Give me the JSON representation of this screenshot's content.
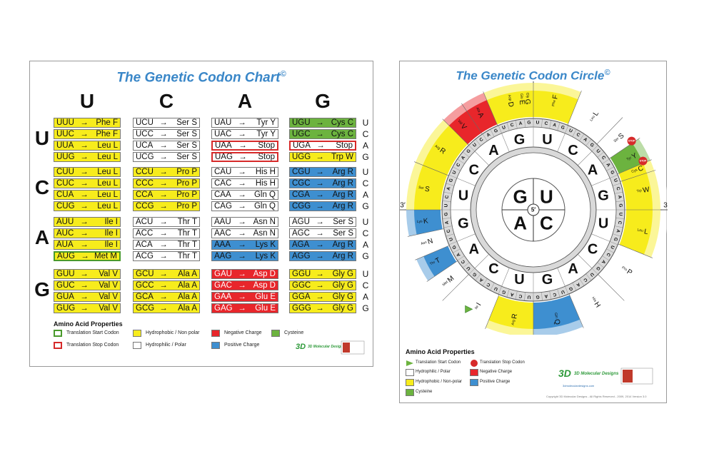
{
  "chart": {
    "title": "The Genetic Codon Chart",
    "title_mark": "©",
    "columns": [
      "U",
      "C",
      "A",
      "G"
    ],
    "rows": [
      "U",
      "C",
      "A",
      "G"
    ],
    "third": [
      "U",
      "C",
      "A",
      "G"
    ],
    "cells": [
      [
        {
          "c": "UUU",
          "a": "Phe F",
          "t": "hphob"
        },
        {
          "c": "UUC",
          "a": "Phe F",
          "t": "hphob"
        },
        {
          "c": "UUA",
          "a": "Leu L",
          "t": "hphob"
        },
        {
          "c": "UUG",
          "a": "Leu L",
          "t": "hphob"
        }
      ],
      [
        {
          "c": "UCU",
          "a": "Ser S",
          "t": "pol"
        },
        {
          "c": "UCC",
          "a": "Ser S",
          "t": "pol"
        },
        {
          "c": "UCA",
          "a": "Ser S",
          "t": "pol"
        },
        {
          "c": "UCG",
          "a": "Ser S",
          "t": "pol"
        }
      ],
      [
        {
          "c": "UAU",
          "a": "Tyr Y",
          "t": "pol"
        },
        {
          "c": "UAC",
          "a": "Tyr Y",
          "t": "pol"
        },
        {
          "c": "UAA",
          "a": "Stop",
          "t": "pol",
          "b": "stop"
        },
        {
          "c": "UAG",
          "a": "Stop",
          "t": "pol",
          "b": "stop"
        }
      ],
      [
        {
          "c": "UGU",
          "a": "Cys C",
          "t": "cys"
        },
        {
          "c": "UGC",
          "a": "Cys C",
          "t": "cys"
        },
        {
          "c": "UGA",
          "a": "Stop",
          "t": "pol",
          "b": "stop"
        },
        {
          "c": "UGG",
          "a": "Trp W",
          "t": "hphob"
        }
      ],
      [
        {
          "c": "CUU",
          "a": "Leu L",
          "t": "hphob"
        },
        {
          "c": "CUC",
          "a": "Leu L",
          "t": "hphob"
        },
        {
          "c": "CUA",
          "a": "Leu L",
          "t": "hphob"
        },
        {
          "c": "CUG",
          "a": "Leu L",
          "t": "hphob"
        }
      ],
      [
        {
          "c": "CCU",
          "a": "Pro P",
          "t": "hphob"
        },
        {
          "c": "CCC",
          "a": "Pro P",
          "t": "hphob"
        },
        {
          "c": "CCA",
          "a": "Pro P",
          "t": "hphob"
        },
        {
          "c": "CCG",
          "a": "Pro P",
          "t": "hphob"
        }
      ],
      [
        {
          "c": "CAU",
          "a": "His H",
          "t": "pol"
        },
        {
          "c": "CAC",
          "a": "His H",
          "t": "pol"
        },
        {
          "c": "CAA",
          "a": "Gln Q",
          "t": "pol"
        },
        {
          "c": "CAG",
          "a": "Gln Q",
          "t": "pol"
        }
      ],
      [
        {
          "c": "CGU",
          "a": "Arg R",
          "t": "pos"
        },
        {
          "c": "CGC",
          "a": "Arg R",
          "t": "pos"
        },
        {
          "c": "CGA",
          "a": "Arg R",
          "t": "pos"
        },
        {
          "c": "CGG",
          "a": "Arg R",
          "t": "pos"
        }
      ],
      [
        {
          "c": "AUU",
          "a": "Ile I",
          "t": "hphob"
        },
        {
          "c": "AUC",
          "a": "Ile I",
          "t": "hphob"
        },
        {
          "c": "AUA",
          "a": "Ile I",
          "t": "hphob"
        },
        {
          "c": "AUG",
          "a": "Met M",
          "t": "hphob",
          "b": "start"
        }
      ],
      [
        {
          "c": "ACU",
          "a": "Thr T",
          "t": "pol"
        },
        {
          "c": "ACC",
          "a": "Thr T",
          "t": "pol"
        },
        {
          "c": "ACA",
          "a": "Thr T",
          "t": "pol"
        },
        {
          "c": "ACG",
          "a": "Thr T",
          "t": "pol"
        }
      ],
      [
        {
          "c": "AAU",
          "a": "Asn N",
          "t": "pol"
        },
        {
          "c": "AAC",
          "a": "Asn N",
          "t": "pol"
        },
        {
          "c": "AAA",
          "a": "Lys K",
          "t": "pos"
        },
        {
          "c": "AAG",
          "a": "Lys K",
          "t": "pos"
        }
      ],
      [
        {
          "c": "AGU",
          "a": "Ser S",
          "t": "pol"
        },
        {
          "c": "AGC",
          "a": "Ser S",
          "t": "pol"
        },
        {
          "c": "AGA",
          "a": "Arg R",
          "t": "pos"
        },
        {
          "c": "AGG",
          "a": "Arg R",
          "t": "pos"
        }
      ],
      [
        {
          "c": "GUU",
          "a": "Val V",
          "t": "hphob"
        },
        {
          "c": "GUC",
          "a": "Val V",
          "t": "hphob"
        },
        {
          "c": "GUA",
          "a": "Val V",
          "t": "hphob"
        },
        {
          "c": "GUG",
          "a": "Val V",
          "t": "hphob"
        }
      ],
      [
        {
          "c": "GCU",
          "a": "Ala A",
          "t": "hphob"
        },
        {
          "c": "GCC",
          "a": "Ala A",
          "t": "hphob"
        },
        {
          "c": "GCA",
          "a": "Ala A",
          "t": "hphob"
        },
        {
          "c": "GCG",
          "a": "Ala A",
          "t": "hphob"
        }
      ],
      [
        {
          "c": "GAU",
          "a": "Asp D",
          "t": "neg"
        },
        {
          "c": "GAC",
          "a": "Asp D",
          "t": "neg"
        },
        {
          "c": "GAA",
          "a": "Glu E",
          "t": "neg"
        },
        {
          "c": "GAG",
          "a": "Glu E",
          "t": "neg"
        }
      ],
      [
        {
          "c": "GGU",
          "a": "Gly G",
          "t": "hphob"
        },
        {
          "c": "GGC",
          "a": "Gly G",
          "t": "hphob"
        },
        {
          "c": "GGA",
          "a": "Gly G",
          "t": "hphob"
        },
        {
          "c": "GGG",
          "a": "Gly G",
          "t": "hphob"
        }
      ]
    ],
    "legend_title": "Amino Acid Properties",
    "legend": {
      "start": "Translation Start Codon",
      "stop": "Translation Stop Codon",
      "hphob": "Hydrophobic / Non polar",
      "pol": "Hydrophilic / Polar",
      "neg": "Negative Charge",
      "pos": "Positive Charge",
      "cys": "Cysteine"
    },
    "logo_text": "3D Molecular Designs"
  },
  "circle": {
    "title": "The Genetic Codon Circle",
    "title_mark": "©",
    "prime3": "3′",
    "prime5": "5′",
    "inner": [
      "U",
      "C",
      "A",
      "G"
    ],
    "ring2": [
      "U",
      "C",
      "A",
      "G",
      "U",
      "C",
      "A",
      "G",
      "U",
      "C",
      "A",
      "G",
      "U",
      "C",
      "A",
      "G"
    ],
    "ring3": [
      "U",
      "C",
      "A",
      "G",
      "U",
      "C",
      "A",
      "G",
      "U",
      "C",
      "A",
      "G",
      "U",
      "C",
      "A",
      "G",
      "U",
      "C",
      "A",
      "G",
      "U",
      "C",
      "A",
      "G",
      "U",
      "C",
      "A",
      "G",
      "U",
      "C",
      "A",
      "G",
      "U",
      "C",
      "A",
      "G",
      "U",
      "C",
      "A",
      "G",
      "U",
      "C",
      "A",
      "G",
      "U",
      "C",
      "A",
      "G",
      "U",
      "C",
      "A",
      "G",
      "U",
      "C",
      "A",
      "G",
      "U",
      "C",
      "A",
      "G",
      "U",
      "C",
      "A",
      "G"
    ],
    "aa_labels": [
      {
        "l": "Phe",
        "s": "F"
      },
      {
        "l": "Leu",
        "s": "L"
      },
      {
        "l": "Ser",
        "s": "S"
      },
      {
        "l": "Tyr",
        "s": "Y"
      },
      {
        "l": "Cys",
        "s": "C"
      },
      {
        "l": "Trp",
        "s": "W"
      },
      {
        "l": "Leu",
        "s": "L"
      },
      {
        "l": "Pro",
        "s": "P"
      },
      {
        "l": "His",
        "s": "H"
      },
      {
        "l": "Gln",
        "s": "Q"
      },
      {
        "l": "Arg",
        "s": "R"
      },
      {
        "l": "Ile",
        "s": "I"
      },
      {
        "l": "Met",
        "s": "M"
      },
      {
        "l": "Thr",
        "s": "T"
      },
      {
        "l": "Asn",
        "s": "N"
      },
      {
        "l": "Lys",
        "s": "K"
      },
      {
        "l": "Ser",
        "s": "S"
      },
      {
        "l": "Arg",
        "s": "R"
      },
      {
        "l": "Val",
        "s": "V"
      },
      {
        "l": "Ala",
        "s": "A"
      },
      {
        "l": "Asp",
        "s": "D"
      },
      {
        "l": "Glu",
        "s": "E"
      },
      {
        "l": "Gly",
        "s": "G"
      }
    ],
    "stop_label": "STOP",
    "legend_title": "Amino Acid Properties",
    "legend": {
      "start": "Translation Start Codon",
      "stop": "Translation Stop Codon",
      "pol": "Hydrophilic / Polar",
      "neg": "Negative Charge",
      "hphob": "Hydrophobic / Non-polar",
      "pos": "Positive Charge",
      "cys": "Cysteine"
    },
    "logo_text": "3D Molecular Designs",
    "url": "3dmoleculardesigns.com",
    "copyright": "Copyright 3D Molecular Designs - All Rights Reserved - 2009, 2014     Version 3.0"
  },
  "colors": {
    "title": "#3a87c8",
    "hphob": "#f7ec1c",
    "pol": "#ffffff",
    "neg": "#e8262b",
    "pos": "#3e8fd0",
    "cys": "#6cb33f",
    "stop_border": "#d62a2a",
    "start_border": "#4a9a2c"
  }
}
